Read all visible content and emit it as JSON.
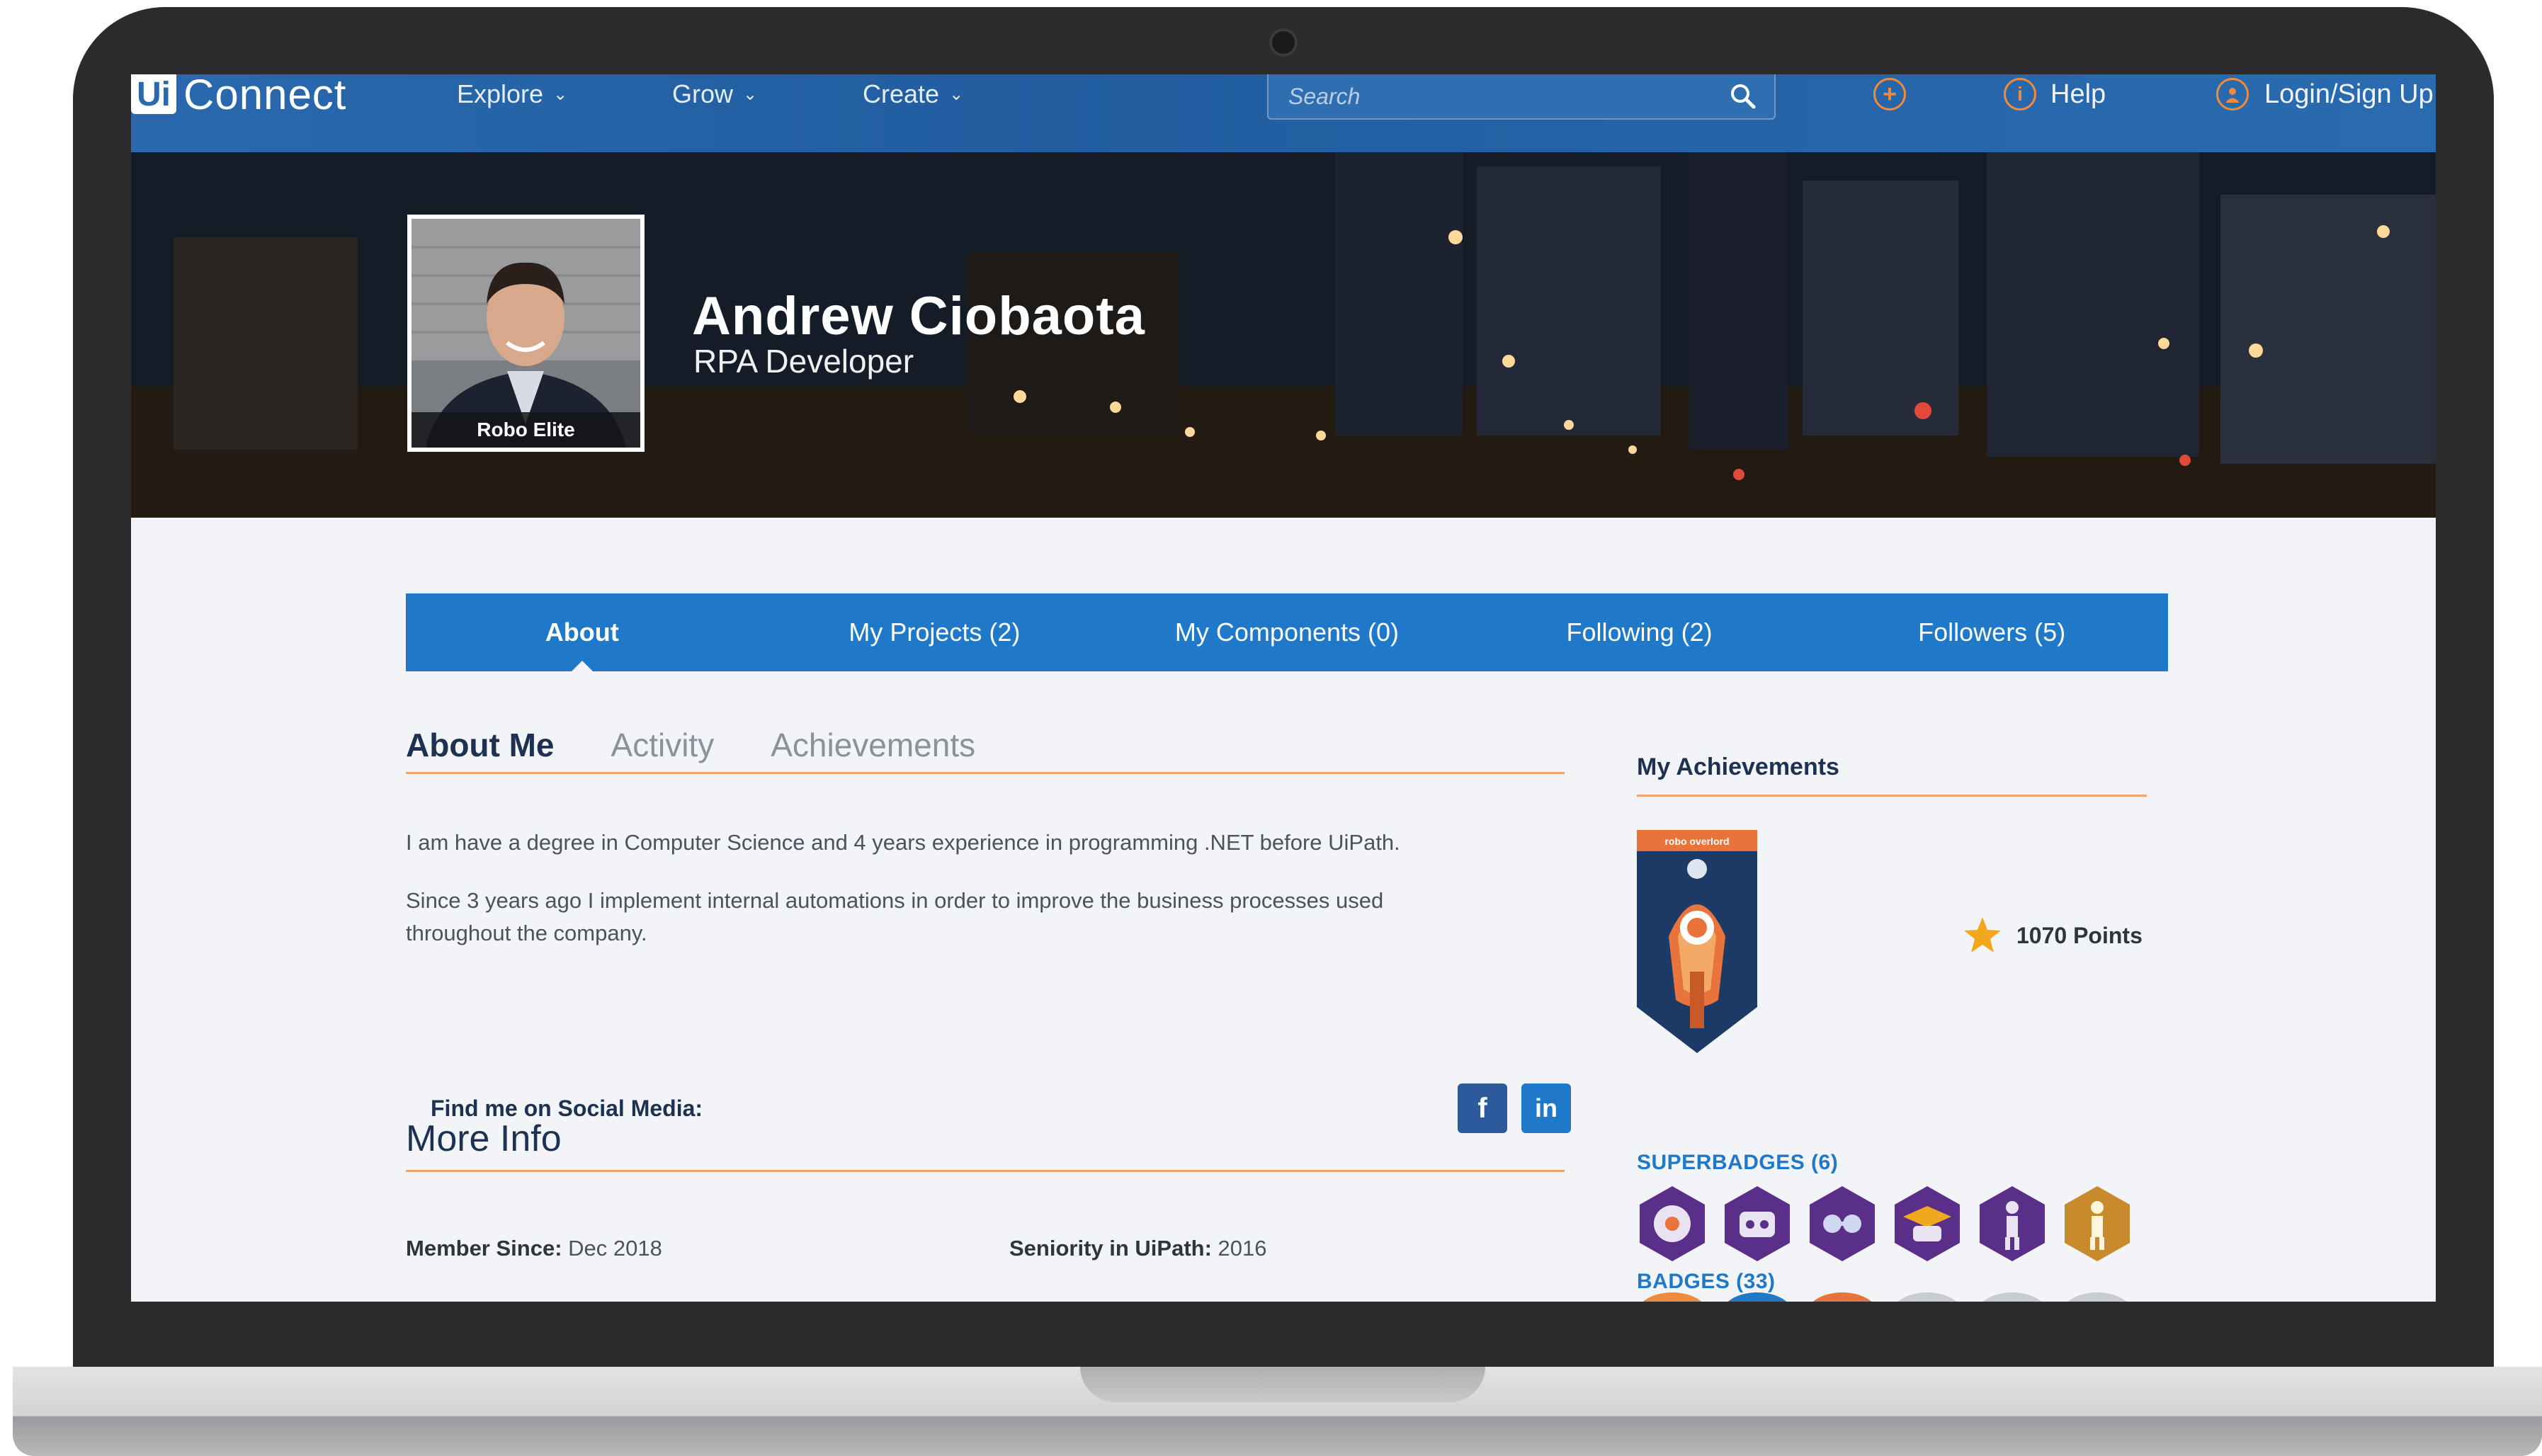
{
  "nav": {
    "logo_box": "Ui",
    "logo_text": "Connect",
    "menus": [
      {
        "label": "Explore"
      },
      {
        "label": "Grow"
      },
      {
        "label": "Create"
      }
    ],
    "search_placeholder": "Search",
    "add_glyph": "+",
    "help_glyph": "i",
    "help_label": "Help",
    "login_label": "Login/Sign Up"
  },
  "profile": {
    "name": "Andrew Ciobaota",
    "role": "RPA Developer",
    "rank_badge": "Robo Elite"
  },
  "tabs": [
    {
      "label": "About",
      "active": true
    },
    {
      "label": "My Projects (2)",
      "active": false
    },
    {
      "label": "My Components (0)",
      "active": false
    },
    {
      "label": "Following (2)",
      "active": false
    },
    {
      "label": "Followers (5)",
      "active": false
    }
  ],
  "subtabs": [
    {
      "label": "About Me",
      "active": true
    },
    {
      "label": "Activity",
      "active": false
    },
    {
      "label": "Achievements",
      "active": false
    }
  ],
  "about": {
    "paragraph1": "I am have a degree in Computer Science and 4 years experience in programming .NET before UiPath.",
    "paragraph2": "Since 3 years ago I implement internal automations in order to improve the business processes used throughout the company.",
    "social_label": "Find me on Social Media:",
    "facebook_glyph": "f",
    "linkedin_glyph": "in"
  },
  "more_info": {
    "title": "More Info",
    "member_since_label": "Member Since:",
    "member_since_value": "Dec 2018",
    "seniority_label": "Seniority in UiPath:",
    "seniority_value": "2016"
  },
  "achievements": {
    "title": "My Achievements",
    "shield_label": "robo overlord",
    "points": "1070 Points",
    "superbadges_label": "SUPERBADGES (6)",
    "badges_label": "BADGES (33)"
  },
  "colors": {
    "nav_blue": "#2a69ae",
    "tab_blue": "#1f78c8",
    "accent_orange": "#f0a36b",
    "facebook": "#2d5a9a",
    "linkedin": "#1f78c8",
    "superbadge_purple": "#5a2f8a",
    "superbadge_gold": "#c98a2e"
  }
}
